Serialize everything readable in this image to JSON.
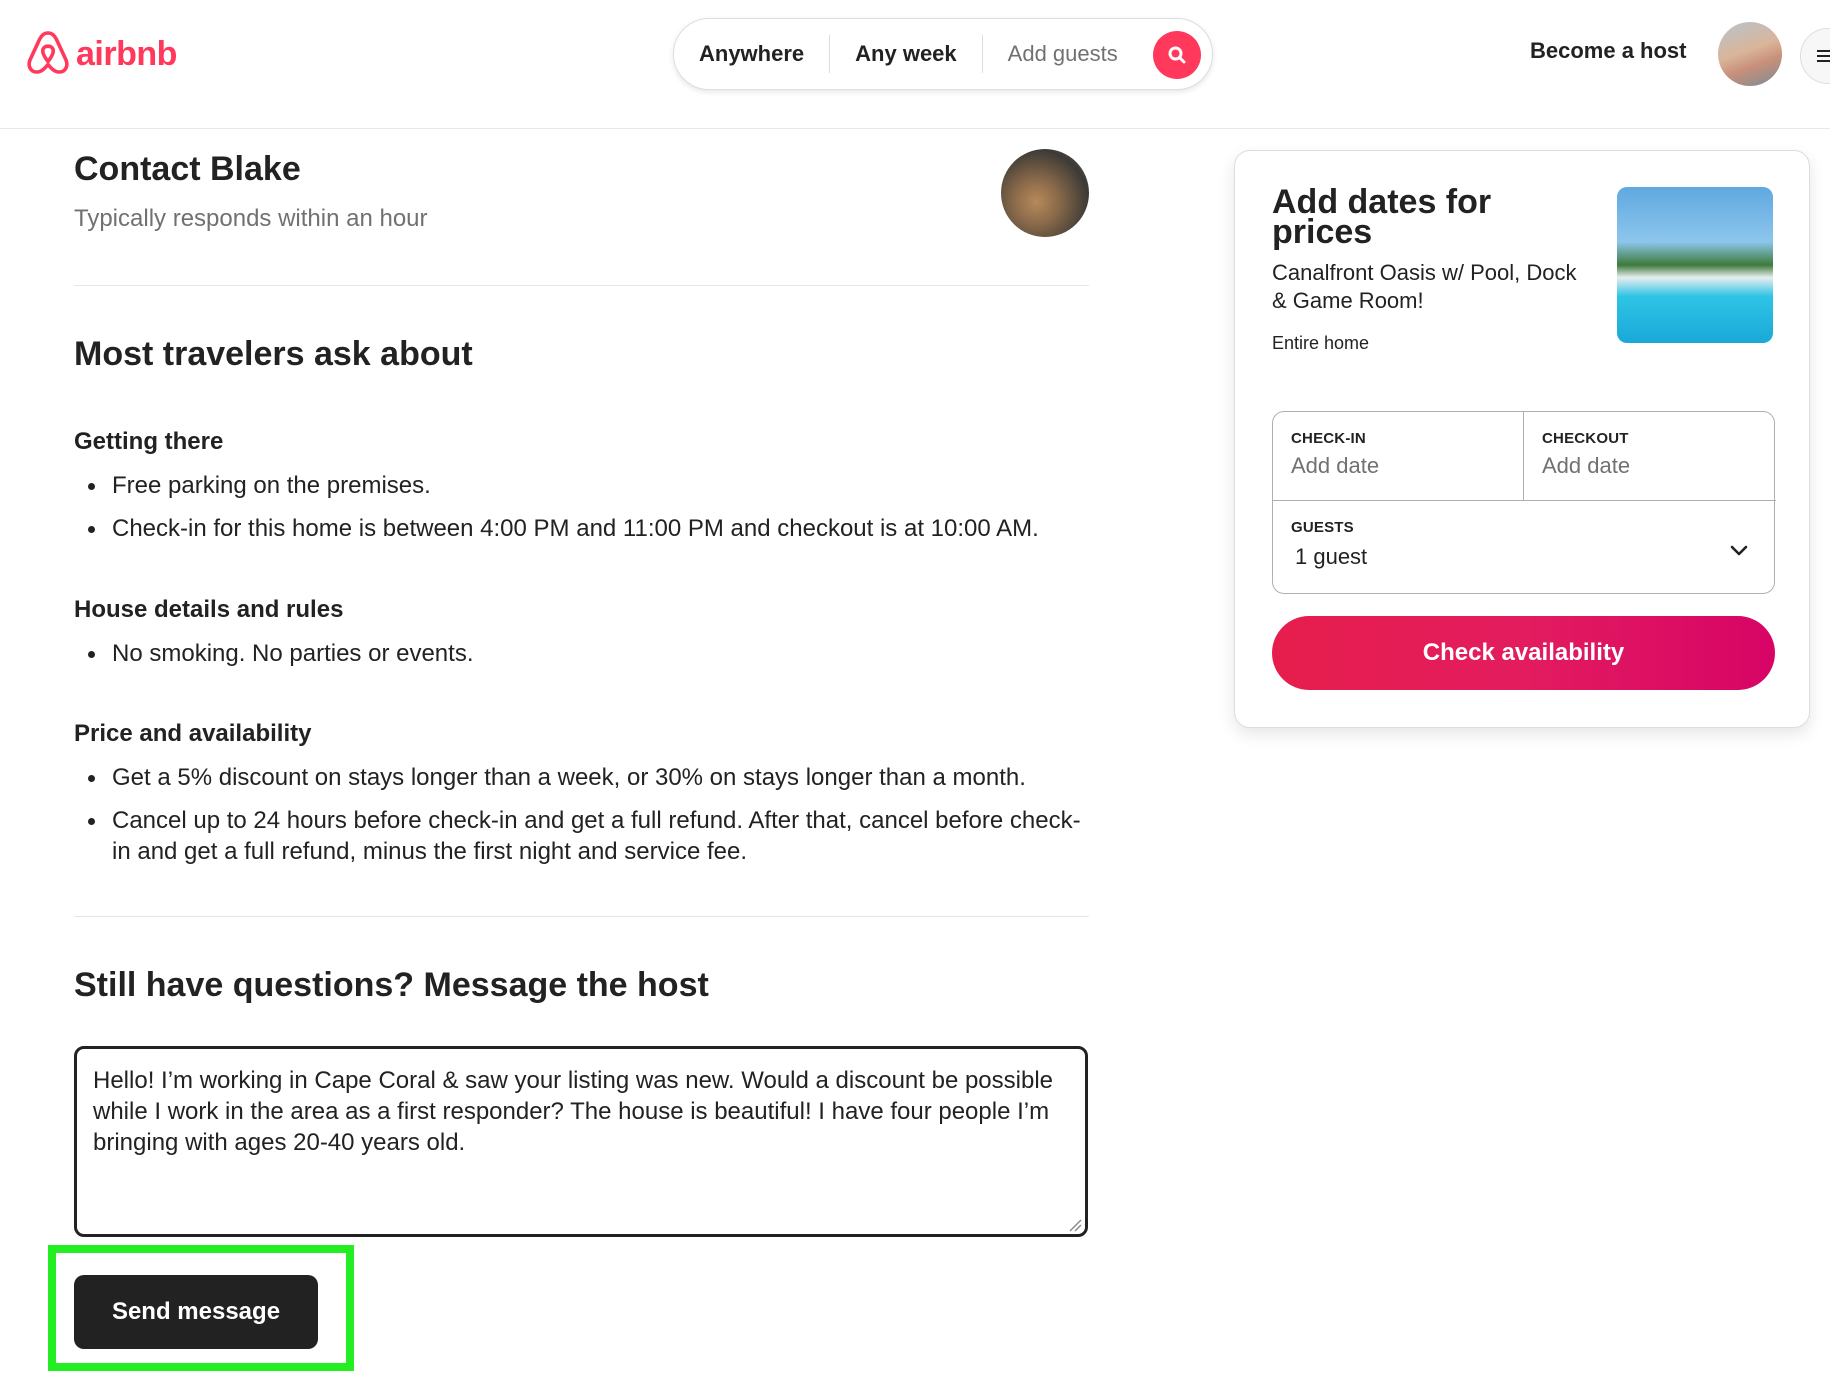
{
  "header": {
    "logo_text": "airbnb",
    "search": {
      "anywhere": "Anywhere",
      "any_week": "Any week",
      "add_guests": "Add guests"
    },
    "become_host": "Become a host"
  },
  "contact": {
    "title": "Contact Blake",
    "subtitle": "Typically responds within an hour"
  },
  "faq": {
    "heading": "Most travelers ask about",
    "sections": [
      {
        "title": "Getting there",
        "items": [
          "Free parking on the premises.",
          "Check-in for this home is between 4:00 PM and 11:00 PM and checkout is at 10:00 AM."
        ]
      },
      {
        "title": "House details and rules",
        "items": [
          "No smoking. No parties or events."
        ]
      },
      {
        "title": "Price and availability",
        "items": [
          "Get a 5% discount on stays longer than a week, or 30% on stays longer than a month.",
          "Cancel up to 24 hours before check-in and get a full refund. After that, cancel before check-in and get a full refund, minus the first night and service fee."
        ]
      }
    ]
  },
  "message": {
    "heading": "Still have questions? Message the host",
    "value": "Hello! I’m working in Cape Coral & saw your listing was new. Would a discount be possible while I work in the area as a first responder? The house is beautiful! I have four people I’m bringing with ages 20-40 years old.",
    "send_label": "Send message"
  },
  "card": {
    "title": "Add dates for prices",
    "listing": "Canalfront Oasis w/ Pool, Dock & Game Room!",
    "type": "Entire home",
    "checkin_label": "CHECK-IN",
    "checkin_value": "Add date",
    "checkout_label": "CHECKOUT",
    "checkout_value": "Add date",
    "guests_label": "GUESTS",
    "guests_value": "1 guest",
    "cta": "Check availability"
  },
  "colors": {
    "brand": "#ff385c",
    "highlight": "#22ee22",
    "text": "#222222",
    "muted": "#717171"
  }
}
